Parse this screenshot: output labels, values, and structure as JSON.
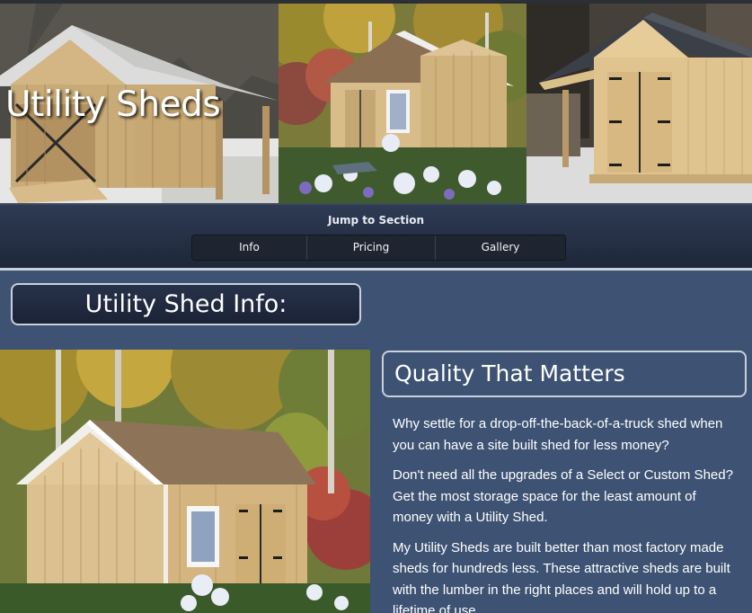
{
  "hero": {
    "title": "Utility Sheds"
  },
  "jump_nav": {
    "title": "Jump to Section",
    "tabs": [
      {
        "label": "Info"
      },
      {
        "label": "Pricing"
      },
      {
        "label": "Gallery"
      }
    ]
  },
  "info": {
    "heading": "Utility Shed Info:",
    "subheading": "Quality That Matters",
    "paragraphs": [
      "Why settle for a drop-off-the-back-of-a-truck shed when you can have a site built shed for less money?",
      "Don't need all the upgrades of a Select or Custom Shed? Get the most storage space for the least amount of money with a Utility Shed.",
      "My Utility Sheds are built better than most factory made sheds for hundreds less. These attractive sheds are built with the lumber in the right places and will hold up to a lifetime of use."
    ]
  },
  "colors": {
    "page_background": "#3e5373",
    "nav_background": "#1d2638",
    "heading_border": "#c8d0dc",
    "text": "#ffffff"
  }
}
